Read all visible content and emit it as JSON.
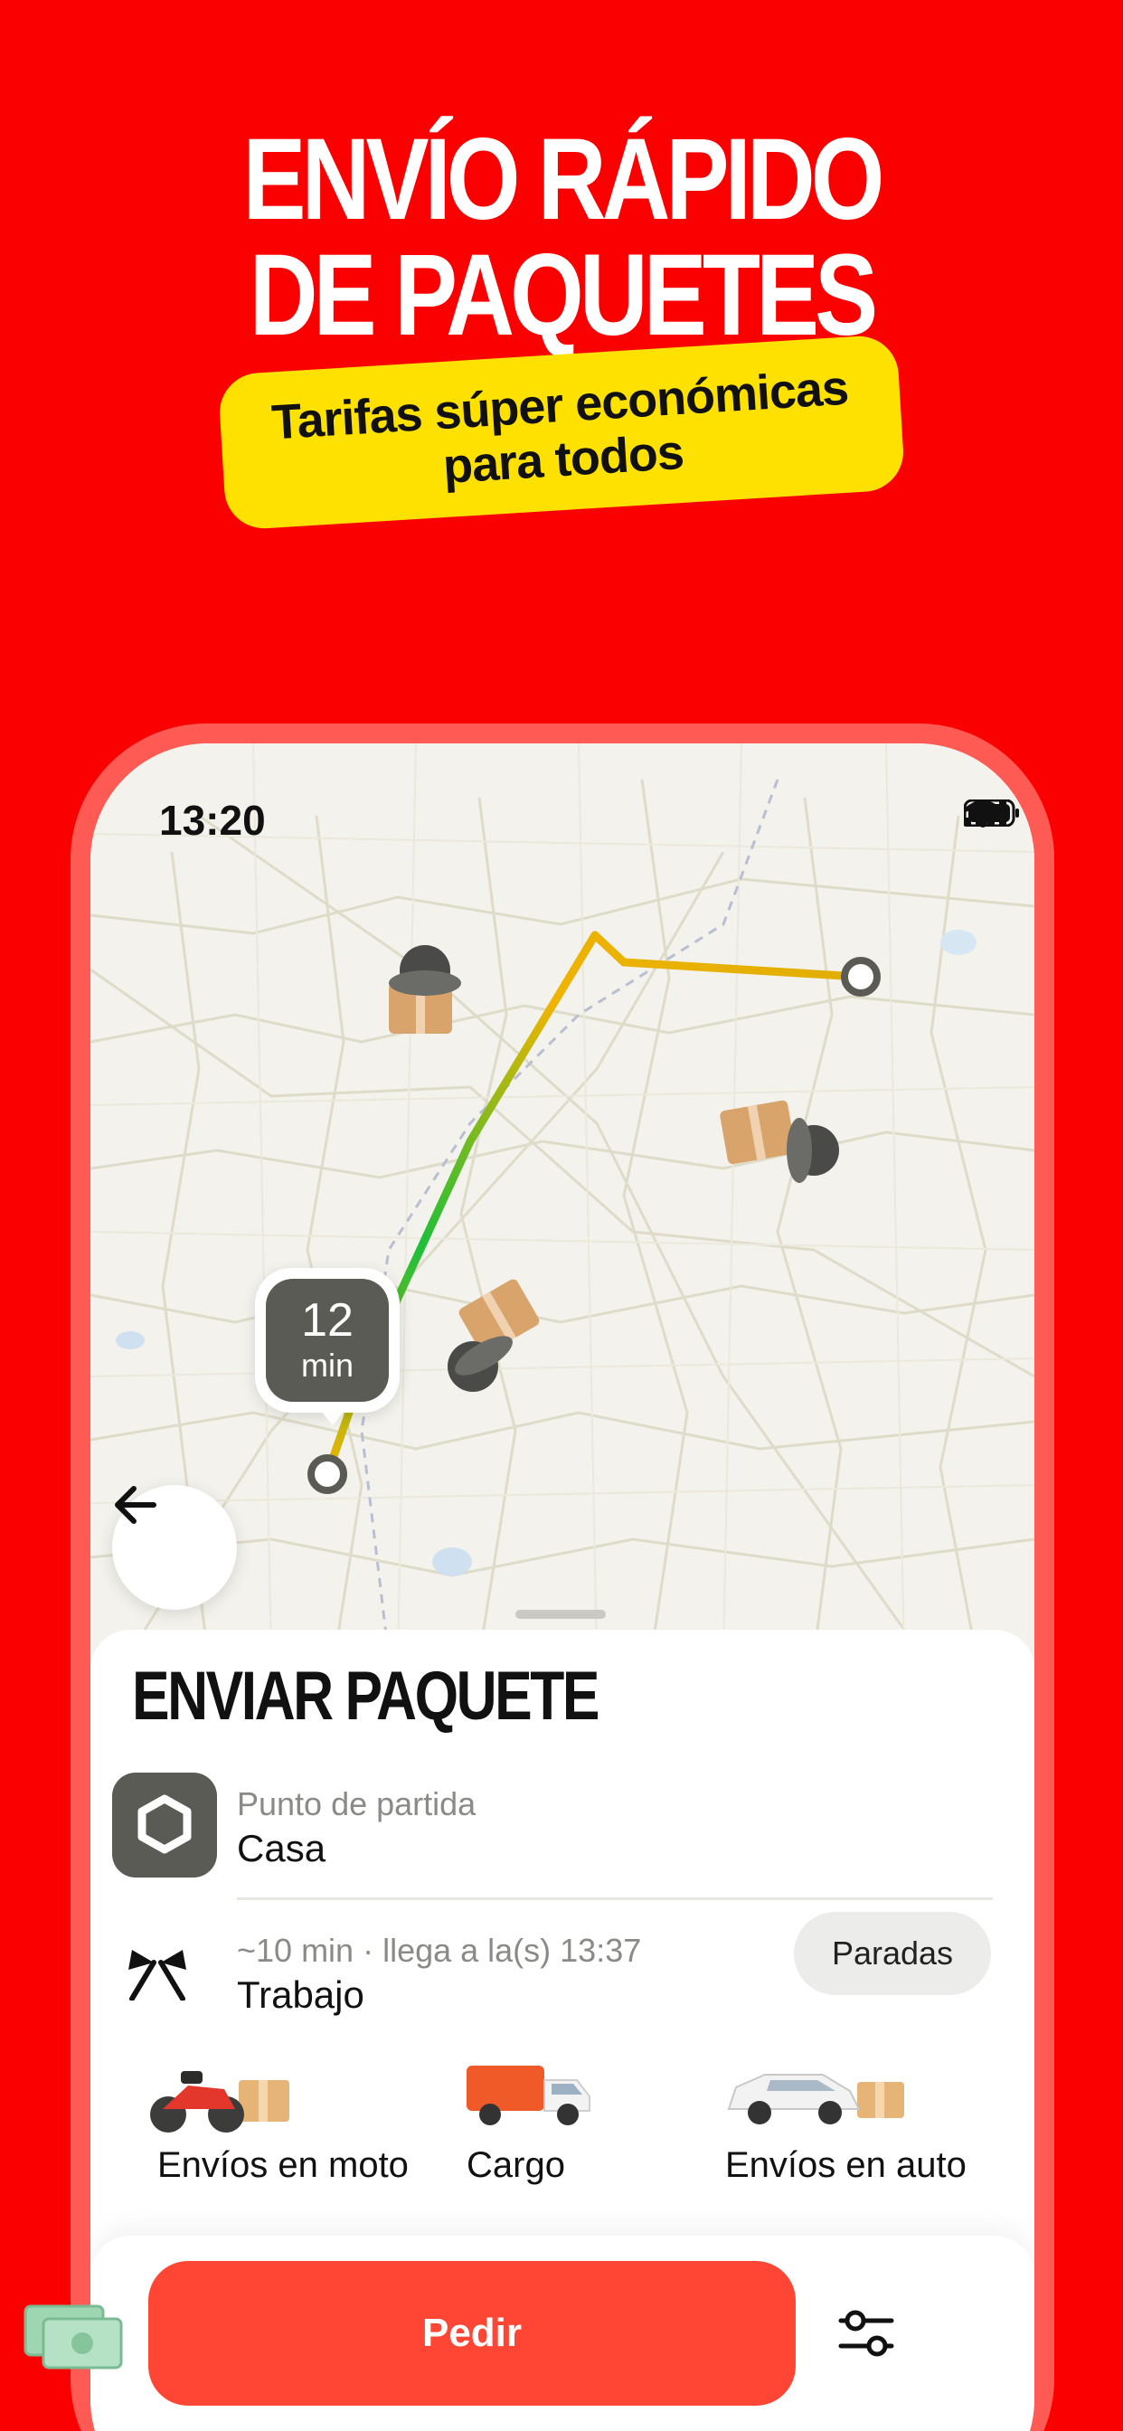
{
  "promo": {
    "title_line1": "ENVÍO RÁPIDO",
    "title_line2": "DE PAQUETES",
    "badge_line1": "Tarifas súper económicas",
    "badge_line2": "para todos"
  },
  "status_bar": {
    "time": "13:20",
    "icons": [
      "cellular-signal-icon",
      "wifi-icon",
      "battery-icon"
    ]
  },
  "map": {
    "eta_value": "12",
    "eta_unit": "min",
    "route_colors": [
      "#f0b400",
      "#1dbf3a"
    ],
    "couriers": [
      "courier-with-package",
      "courier-with-package",
      "courier-with-package"
    ]
  },
  "sheet": {
    "title": "ENVIAR PAQUETE",
    "pickup": {
      "caption": "Punto de partida",
      "value": "Casa"
    },
    "destination": {
      "caption": "~10 min · llega a la(s) 13:37",
      "value": "Trabajo"
    },
    "stops_button": "Paradas",
    "services": [
      {
        "label": "Envíos en moto",
        "icon": "motorcycle-icon"
      },
      {
        "label": "Cargo",
        "icon": "truck-icon"
      },
      {
        "label": "Envíos en auto",
        "icon": "car-icon"
      }
    ]
  },
  "order": {
    "button_label": "Pedir",
    "payment_icon": "cash-icon",
    "settings_icon": "sliders-icon"
  },
  "colors": {
    "background": "#fb0000",
    "badge": "#ffe100",
    "order_button": "#ff4634"
  }
}
